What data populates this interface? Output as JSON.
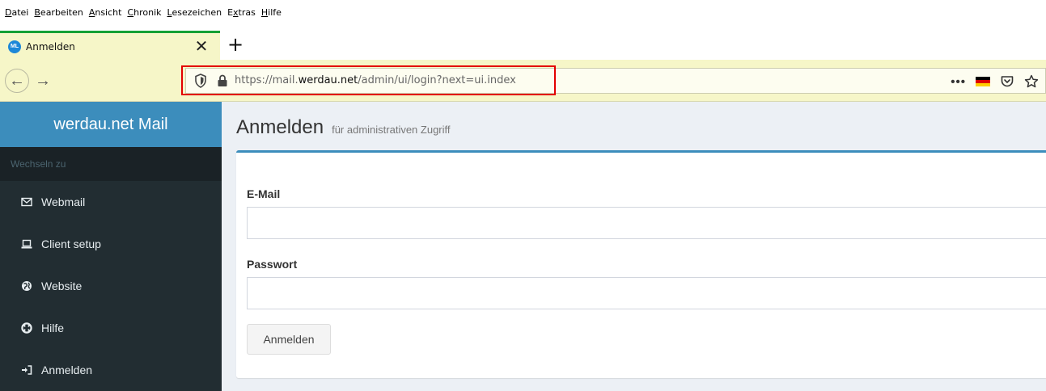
{
  "menubar": {
    "items": [
      {
        "key": "D",
        "rest": "atei"
      },
      {
        "key": "B",
        "rest": "earbeiten"
      },
      {
        "key": "A",
        "rest": "nsicht"
      },
      {
        "key": "C",
        "rest": "hronik"
      },
      {
        "key": "L",
        "rest": "esezeichen"
      },
      {
        "pre": "E",
        "key": "x",
        "rest": "tras"
      },
      {
        "key": "H",
        "rest": "ilfe"
      }
    ]
  },
  "tab": {
    "title": "Anmelden",
    "favicon_text": "ML",
    "close_glyph": "✕"
  },
  "newtab_glyph": "+",
  "nav": {
    "back_glyph": "←",
    "forward_glyph": "→",
    "url_prefix": "https://mail.",
    "url_domain": "werdau.net",
    "url_path": "/admin/ui/login?next=ui.index",
    "menu_dots": "•••"
  },
  "sidebar": {
    "brand": "werdau.net Mail",
    "header": "Wechseln zu",
    "items": [
      {
        "label": "Webmail",
        "icon": "envelope-icon"
      },
      {
        "label": "Client setup",
        "icon": "laptop-icon"
      },
      {
        "label": "Website",
        "icon": "globe-icon"
      },
      {
        "label": "Hilfe",
        "icon": "life-ring-icon"
      },
      {
        "label": "Anmelden",
        "icon": "sign-in-icon"
      }
    ]
  },
  "page": {
    "title": "Anmelden",
    "subtitle": "für administrativen Zugriff"
  },
  "form": {
    "email_label": "E-Mail",
    "email_value": "",
    "password_label": "Passwort",
    "password_value": "",
    "submit_label": "Anmelden"
  },
  "colors": {
    "brand_bg": "#3c8dbc",
    "sidebar_bg": "#222d32",
    "tab_accent": "#15a035",
    "url_highlight": "#e30000",
    "toolbar_bg": "#f6f6c8"
  }
}
